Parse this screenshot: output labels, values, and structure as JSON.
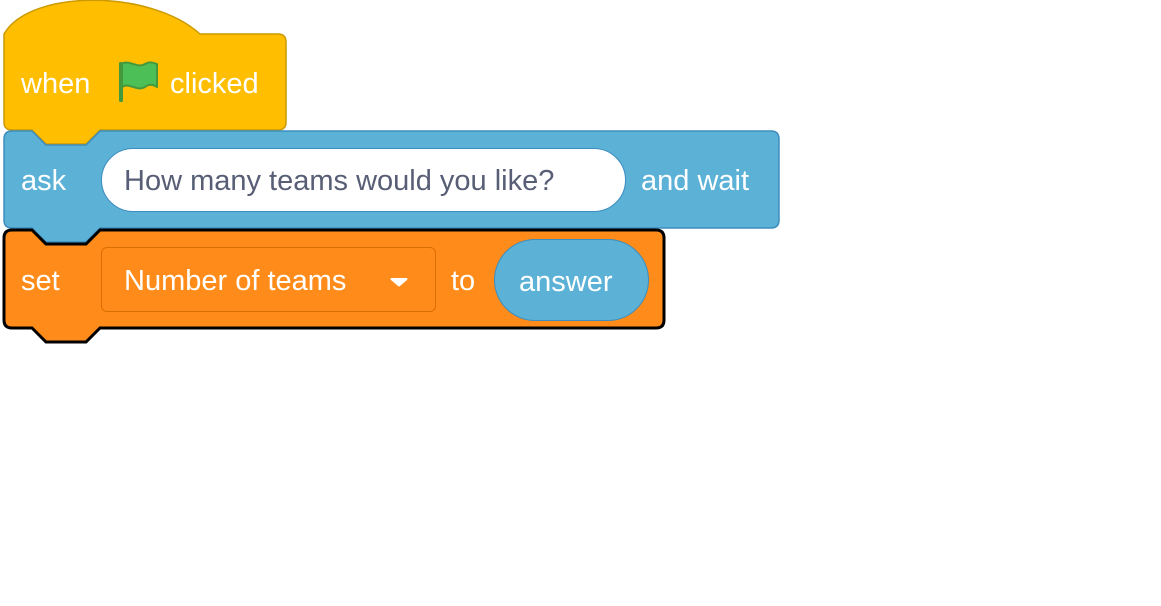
{
  "script": {
    "hat_block": {
      "text_before": "when",
      "icon": "green-flag-icon",
      "text_after": "clicked",
      "fill": "#ffbf00",
      "stroke": "#cc9900"
    },
    "ask_block": {
      "label": "ask",
      "input_value": "How many teams would you like?",
      "suffix": "and wait",
      "fill": "#5cb1d6",
      "stroke": "#3d8dbf"
    },
    "set_block": {
      "label": "set",
      "variable": "Number of teams",
      "dropdown_icon": "caret-down-icon",
      "connector": "to",
      "value_reporter": "answer",
      "fill": "#ff8c1a",
      "stroke": "#000000",
      "reporter_fill": "#5cb1d6",
      "selected": true
    }
  }
}
